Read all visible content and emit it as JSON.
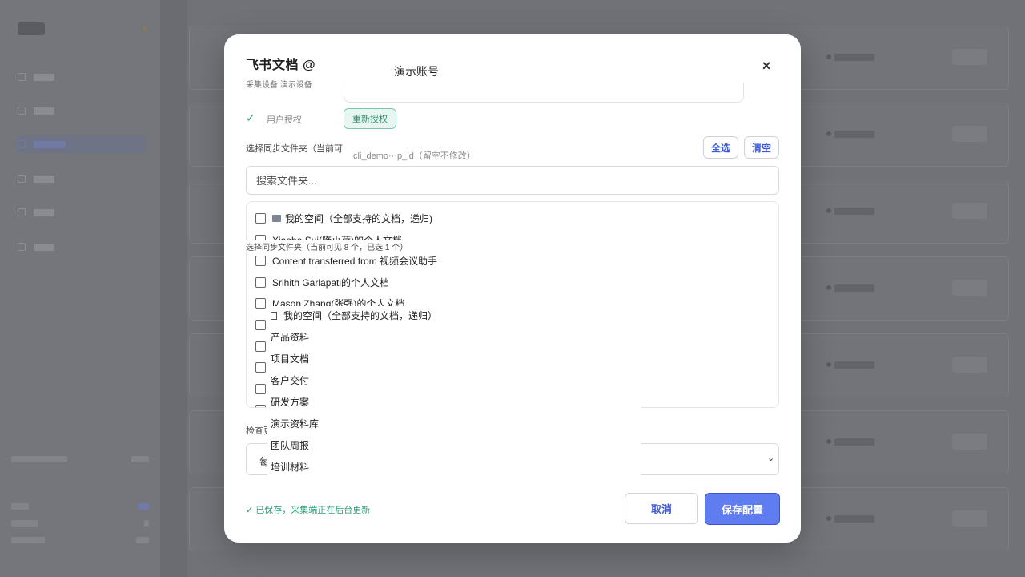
{
  "modal": {
    "title": "飞书文档 @",
    "subtitle": "采集设备  演示设备",
    "close_icon": "×",
    "account_name": "演示账号",
    "auth_check": "✓",
    "auth_label": "用户授权",
    "reauth_label": "重新授权",
    "select_folders_label": "选择同步文件夹（当前可",
    "app_id_hint": "cli_demo···p_id（留空不修改）",
    "select_all": "全选",
    "clear": "清空",
    "search_placeholder": "搜索文件夹...",
    "folders": [
      {
        "label": "我的空间（全部支持的文档，递归)",
        "checked": false,
        "icon": "folder-icon"
      },
      {
        "label": "Xiaohe Sui(隋小荷)的个人文档",
        "checked": false
      },
      {
        "label": "Content transferred from 视频会议助手",
        "checked": false
      },
      {
        "label": "Srihith Garlapati的个人文档",
        "checked": false
      },
      {
        "label": "Mason Zhang(张强)的个人文档",
        "checked": false
      }
    ],
    "overlay": {
      "count_label": "选择同步文件夹（当前可见 8 个，已选 1 个）",
      "first_item": "我的空间（全部支持的文档，递归）",
      "items": [
        "产品资料",
        "项目文档",
        "客户交付",
        "研发方案",
        "演示资料库",
        "团队周报",
        "培训材料"
      ]
    },
    "check_update_label": "检查更",
    "interval_value": "每",
    "saved_status": "✓ 已保存，采集端正在后台更新",
    "cancel_label": "取消",
    "save_label": "保存配置"
  }
}
